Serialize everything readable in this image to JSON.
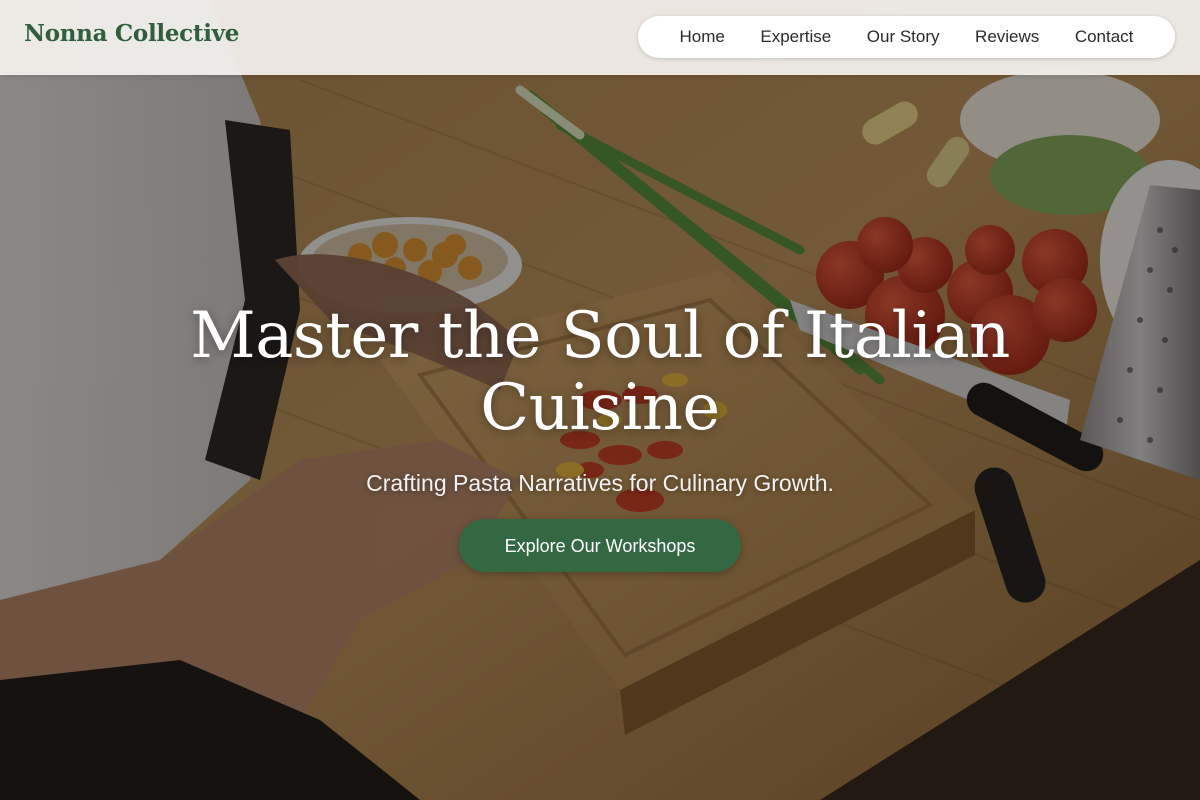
{
  "header": {
    "brand": "Nonna Collective",
    "nav": {
      "home": "Home",
      "expertise": "Expertise",
      "our_story": "Our Story",
      "reviews": "Reviews",
      "contact": "Contact"
    }
  },
  "hero": {
    "title": "Master the Soul of Italian Cuisine",
    "subtitle": "Crafting Pasta Narratives for Culinary Growth.",
    "cta_label": "Explore Our Workshops",
    "background_image": "chef-chopping-tomatoes-on-cutting-board"
  },
  "colors": {
    "brand_green": "#2f5f3c",
    "cta_green": "#346843",
    "header_bg": "#f4f2ee",
    "nav_bg": "#ffffff"
  }
}
